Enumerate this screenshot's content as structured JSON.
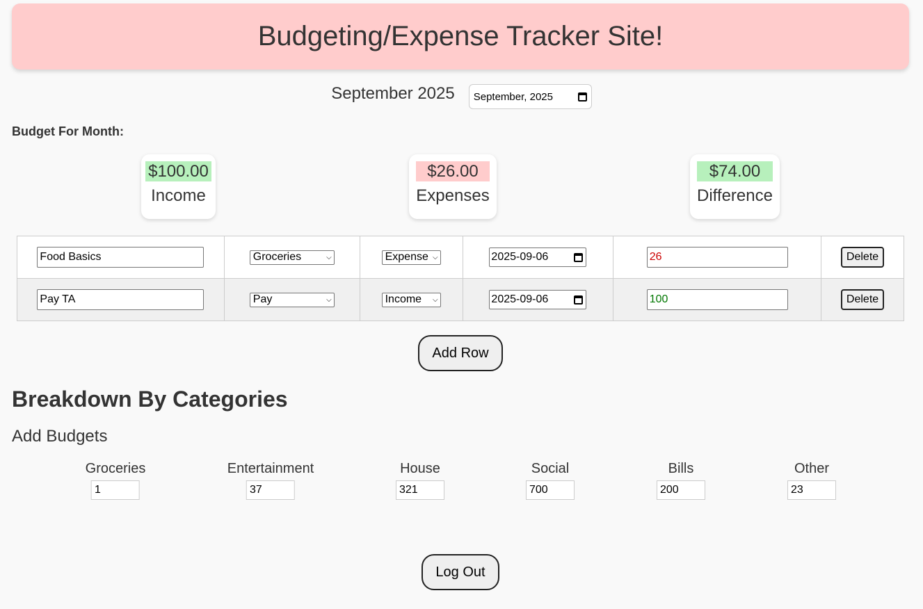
{
  "header": {
    "title": "Budgeting/Expense Tracker Site!"
  },
  "month": {
    "label": "September 2025",
    "picker_value": "September, 2025"
  },
  "budget_label": "Budget For Month:",
  "summary": {
    "income": {
      "amount": "$100.00",
      "label": "Income",
      "color": "#b7f0bc"
    },
    "expenses": {
      "amount": "$26.00",
      "label": "Expenses",
      "color": "#ffcccc"
    },
    "difference": {
      "amount": "$74.00",
      "label": "Difference",
      "color": "#b7f0bc"
    }
  },
  "transactions": [
    {
      "name": "Food Basics",
      "category": "Groceries",
      "type": "Expense",
      "date": "2025-09-06",
      "amount": "26",
      "amount_color": "#cc0000",
      "delete_label": "Delete"
    },
    {
      "name": "Pay TA",
      "category": "Pay",
      "type": "Income",
      "date": "2025-09-06",
      "amount": "100",
      "amount_color": "#007700",
      "delete_label": "Delete"
    }
  ],
  "add_row_label": "Add Row",
  "breakdown": {
    "title": "Breakdown By Categories",
    "subtitle": "Add Budgets",
    "categories": [
      {
        "name": "Groceries",
        "value": "1"
      },
      {
        "name": "Entertainment",
        "value": "37"
      },
      {
        "name": "House",
        "value": "321"
      },
      {
        "name": "Social",
        "value": "700"
      },
      {
        "name": "Bills",
        "value": "200"
      },
      {
        "name": "Other",
        "value": "23"
      }
    ]
  },
  "logout_label": "Log Out"
}
